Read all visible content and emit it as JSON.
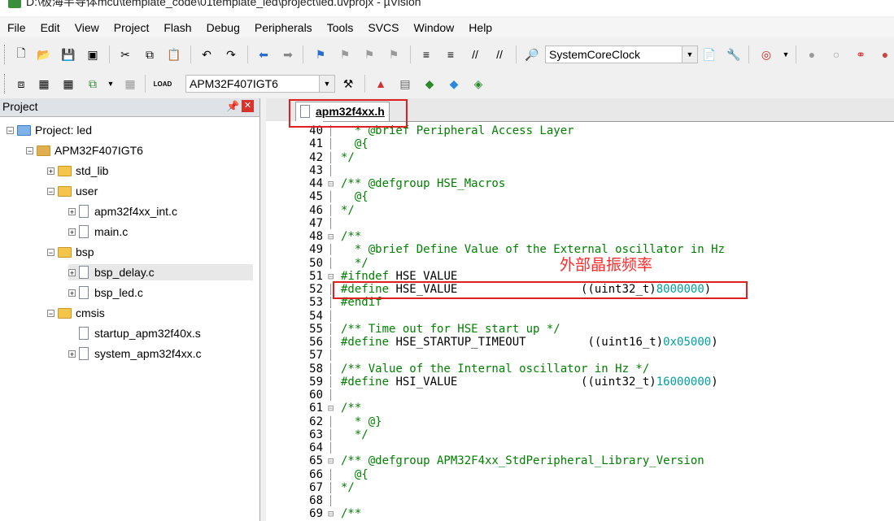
{
  "window": {
    "title": "D:\\极海半导体mcu\\template_code\\01template_led\\project\\led.uvprojx - µVision"
  },
  "menu": [
    "File",
    "Edit",
    "View",
    "Project",
    "Flash",
    "Debug",
    "Peripherals",
    "Tools",
    "SVCS",
    "Window",
    "Help"
  ],
  "toolbar": {
    "function_combo": "SystemCoreClock",
    "target_combo": "APM32F407IGT6"
  },
  "project_panel": {
    "title": "Project",
    "tree": [
      {
        "label": "Project: led",
        "depth": 0,
        "type": "root",
        "exp": "-"
      },
      {
        "label": "APM32F407IGT6",
        "depth": 1,
        "type": "target",
        "exp": "-"
      },
      {
        "label": "std_lib",
        "depth": 2,
        "type": "folder",
        "exp": "+"
      },
      {
        "label": "user",
        "depth": 2,
        "type": "folder",
        "exp": "-"
      },
      {
        "label": "apm32f4xx_int.c",
        "depth": 3,
        "type": "file",
        "exp": "+"
      },
      {
        "label": "main.c",
        "depth": 3,
        "type": "file",
        "exp": "+"
      },
      {
        "label": "bsp",
        "depth": 2,
        "type": "folder",
        "exp": "-"
      },
      {
        "label": "bsp_delay.c",
        "depth": 3,
        "type": "file",
        "exp": "+",
        "selected": true
      },
      {
        "label": "bsp_led.c",
        "depth": 3,
        "type": "file",
        "exp": "+"
      },
      {
        "label": "cmsis",
        "depth": 2,
        "type": "folder",
        "exp": "-"
      },
      {
        "label": "startup_apm32f40x.s",
        "depth": 3,
        "type": "file",
        "exp": ""
      },
      {
        "label": "system_apm32f4xx.c",
        "depth": 3,
        "type": "file",
        "exp": "+"
      }
    ]
  },
  "editor": {
    "tab": "apm32f4xx.h",
    "annotation": "外部晶振频率",
    "lines": [
      {
        "n": "40",
        "fold": "",
        "segs": [
          [
            "cm",
            "  * @brief Peripheral Access Layer"
          ]
        ]
      },
      {
        "n": "41",
        "fold": "",
        "segs": [
          [
            "cm",
            "  @{"
          ]
        ]
      },
      {
        "n": "42",
        "fold": "",
        "segs": [
          [
            "cm",
            "*/"
          ]
        ]
      },
      {
        "n": "43",
        "fold": "",
        "segs": [
          [
            "",
            ""
          ]
        ]
      },
      {
        "n": "44",
        "fold": "⊟",
        "segs": [
          [
            "cm",
            "/** @defgroup HSE_Macros"
          ]
        ]
      },
      {
        "n": "45",
        "fold": "",
        "segs": [
          [
            "cm",
            "  @{"
          ]
        ]
      },
      {
        "n": "46",
        "fold": "",
        "segs": [
          [
            "cm",
            "*/"
          ]
        ]
      },
      {
        "n": "47",
        "fold": "",
        "segs": [
          [
            "",
            ""
          ]
        ]
      },
      {
        "n": "48",
        "fold": "⊟",
        "segs": [
          [
            "cm",
            "/**"
          ]
        ]
      },
      {
        "n": "49",
        "fold": "",
        "segs": [
          [
            "cm",
            "  * @brief Define Value of the External oscillator in Hz"
          ]
        ]
      },
      {
        "n": "50",
        "fold": "",
        "segs": [
          [
            "cm",
            "  */"
          ]
        ]
      },
      {
        "n": "51",
        "fold": "⊟",
        "segs": [
          [
            "pp",
            "#ifndef"
          ],
          [
            "",
            " HSE_VALUE"
          ]
        ]
      },
      {
        "n": "52",
        "fold": "",
        "segs": [
          [
            "pp",
            "#define"
          ],
          [
            "",
            " HSE_VALUE                  ((uint32_t)"
          ],
          [
            "num",
            "8000000"
          ],
          [
            "",
            ")"
          ]
        ]
      },
      {
        "n": "53",
        "fold": "",
        "segs": [
          [
            "pp",
            "#endif"
          ]
        ]
      },
      {
        "n": "54",
        "fold": "",
        "segs": [
          [
            "",
            ""
          ]
        ]
      },
      {
        "n": "55",
        "fold": "",
        "segs": [
          [
            "cm",
            "/** Time out for HSE start up */"
          ]
        ]
      },
      {
        "n": "56",
        "fold": "",
        "segs": [
          [
            "pp",
            "#define"
          ],
          [
            "",
            " HSE_STARTUP_TIMEOUT         ((uint16_t)"
          ],
          [
            "num",
            "0x05000"
          ],
          [
            "",
            ")"
          ]
        ]
      },
      {
        "n": "57",
        "fold": "",
        "segs": [
          [
            "",
            ""
          ]
        ]
      },
      {
        "n": "58",
        "fold": "",
        "segs": [
          [
            "cm",
            "/** Value of the Internal oscillator in Hz */"
          ]
        ]
      },
      {
        "n": "59",
        "fold": "",
        "segs": [
          [
            "pp",
            "#define"
          ],
          [
            "",
            " HSI_VALUE                  ((uint32_t)"
          ],
          [
            "num",
            "16000000"
          ],
          [
            "",
            ")"
          ]
        ]
      },
      {
        "n": "60",
        "fold": "",
        "segs": [
          [
            "",
            ""
          ]
        ]
      },
      {
        "n": "61",
        "fold": "⊟",
        "segs": [
          [
            "cm",
            "/**"
          ]
        ]
      },
      {
        "n": "62",
        "fold": "",
        "segs": [
          [
            "cm",
            "  * @}"
          ]
        ]
      },
      {
        "n": "63",
        "fold": "",
        "segs": [
          [
            "cm",
            "  */"
          ]
        ]
      },
      {
        "n": "64",
        "fold": "",
        "segs": [
          [
            "",
            ""
          ]
        ]
      },
      {
        "n": "65",
        "fold": "⊟",
        "segs": [
          [
            "cm",
            "/** @defgroup APM32F4xx_StdPeripheral_Library_Version"
          ]
        ]
      },
      {
        "n": "66",
        "fold": "",
        "segs": [
          [
            "cm",
            "  @{"
          ]
        ]
      },
      {
        "n": "67",
        "fold": "",
        "segs": [
          [
            "cm",
            "*/"
          ]
        ]
      },
      {
        "n": "68",
        "fold": "",
        "segs": [
          [
            "",
            ""
          ]
        ]
      },
      {
        "n": "69",
        "fold": "⊟",
        "segs": [
          [
            "cm",
            "/**"
          ]
        ]
      }
    ]
  }
}
